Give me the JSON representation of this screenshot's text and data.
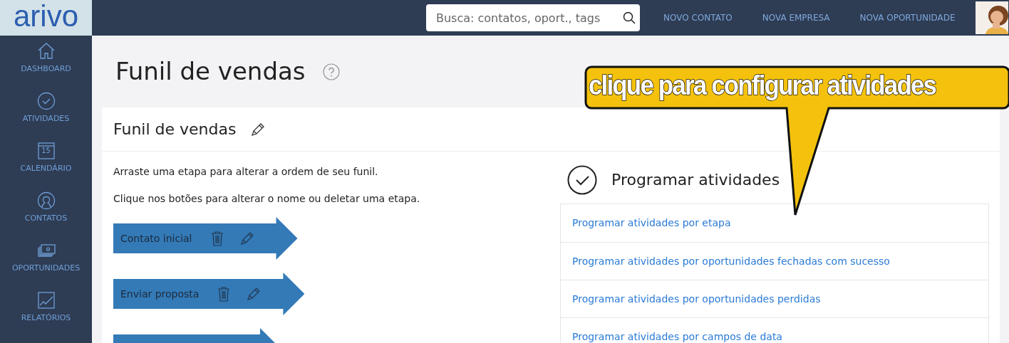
{
  "logo": "arivo",
  "search": {
    "placeholder": "Busca: contatos, oport., tags"
  },
  "top_links": [
    "NOVO CONTATO",
    "NOVA EMPRESA",
    "NOVA OPORTUNIDADE"
  ],
  "sidebar": {
    "items": [
      {
        "kind": "home",
        "label": "DASHBOARD"
      },
      {
        "kind": "check",
        "label": "ATIVIDADES"
      },
      {
        "kind": "calendar",
        "label": "CALENDÁRIO",
        "icon_text": "15"
      },
      {
        "kind": "person",
        "label": "CONTATOS"
      },
      {
        "kind": "money",
        "label": "OPORTUNIDADES"
      },
      {
        "kind": "chart",
        "label": "RELATÓRIOS"
      }
    ]
  },
  "page_title": "Funil de vendas",
  "card": {
    "title": "Funil de vendas",
    "instructions": [
      "Arraste uma etapa para alterar a ordem de seu funil.",
      "Clique nos botões para alterar o nome ou deletar uma etapa."
    ],
    "stages": [
      {
        "kind": "labeled",
        "label": "Contato inicial"
      },
      {
        "kind": "labeled",
        "label": "Enviar proposta"
      },
      {
        "kind": "cut_off"
      }
    ],
    "activities": {
      "title": "Programar atividades",
      "links": [
        "Programar atividades por etapa",
        "Programar atividades por oportunidades fechadas com sucesso",
        "Programar atividades por oportunidades perdidas",
        "Programar atividades por campos de data"
      ]
    }
  },
  "callout": "clique para configurar atividades"
}
